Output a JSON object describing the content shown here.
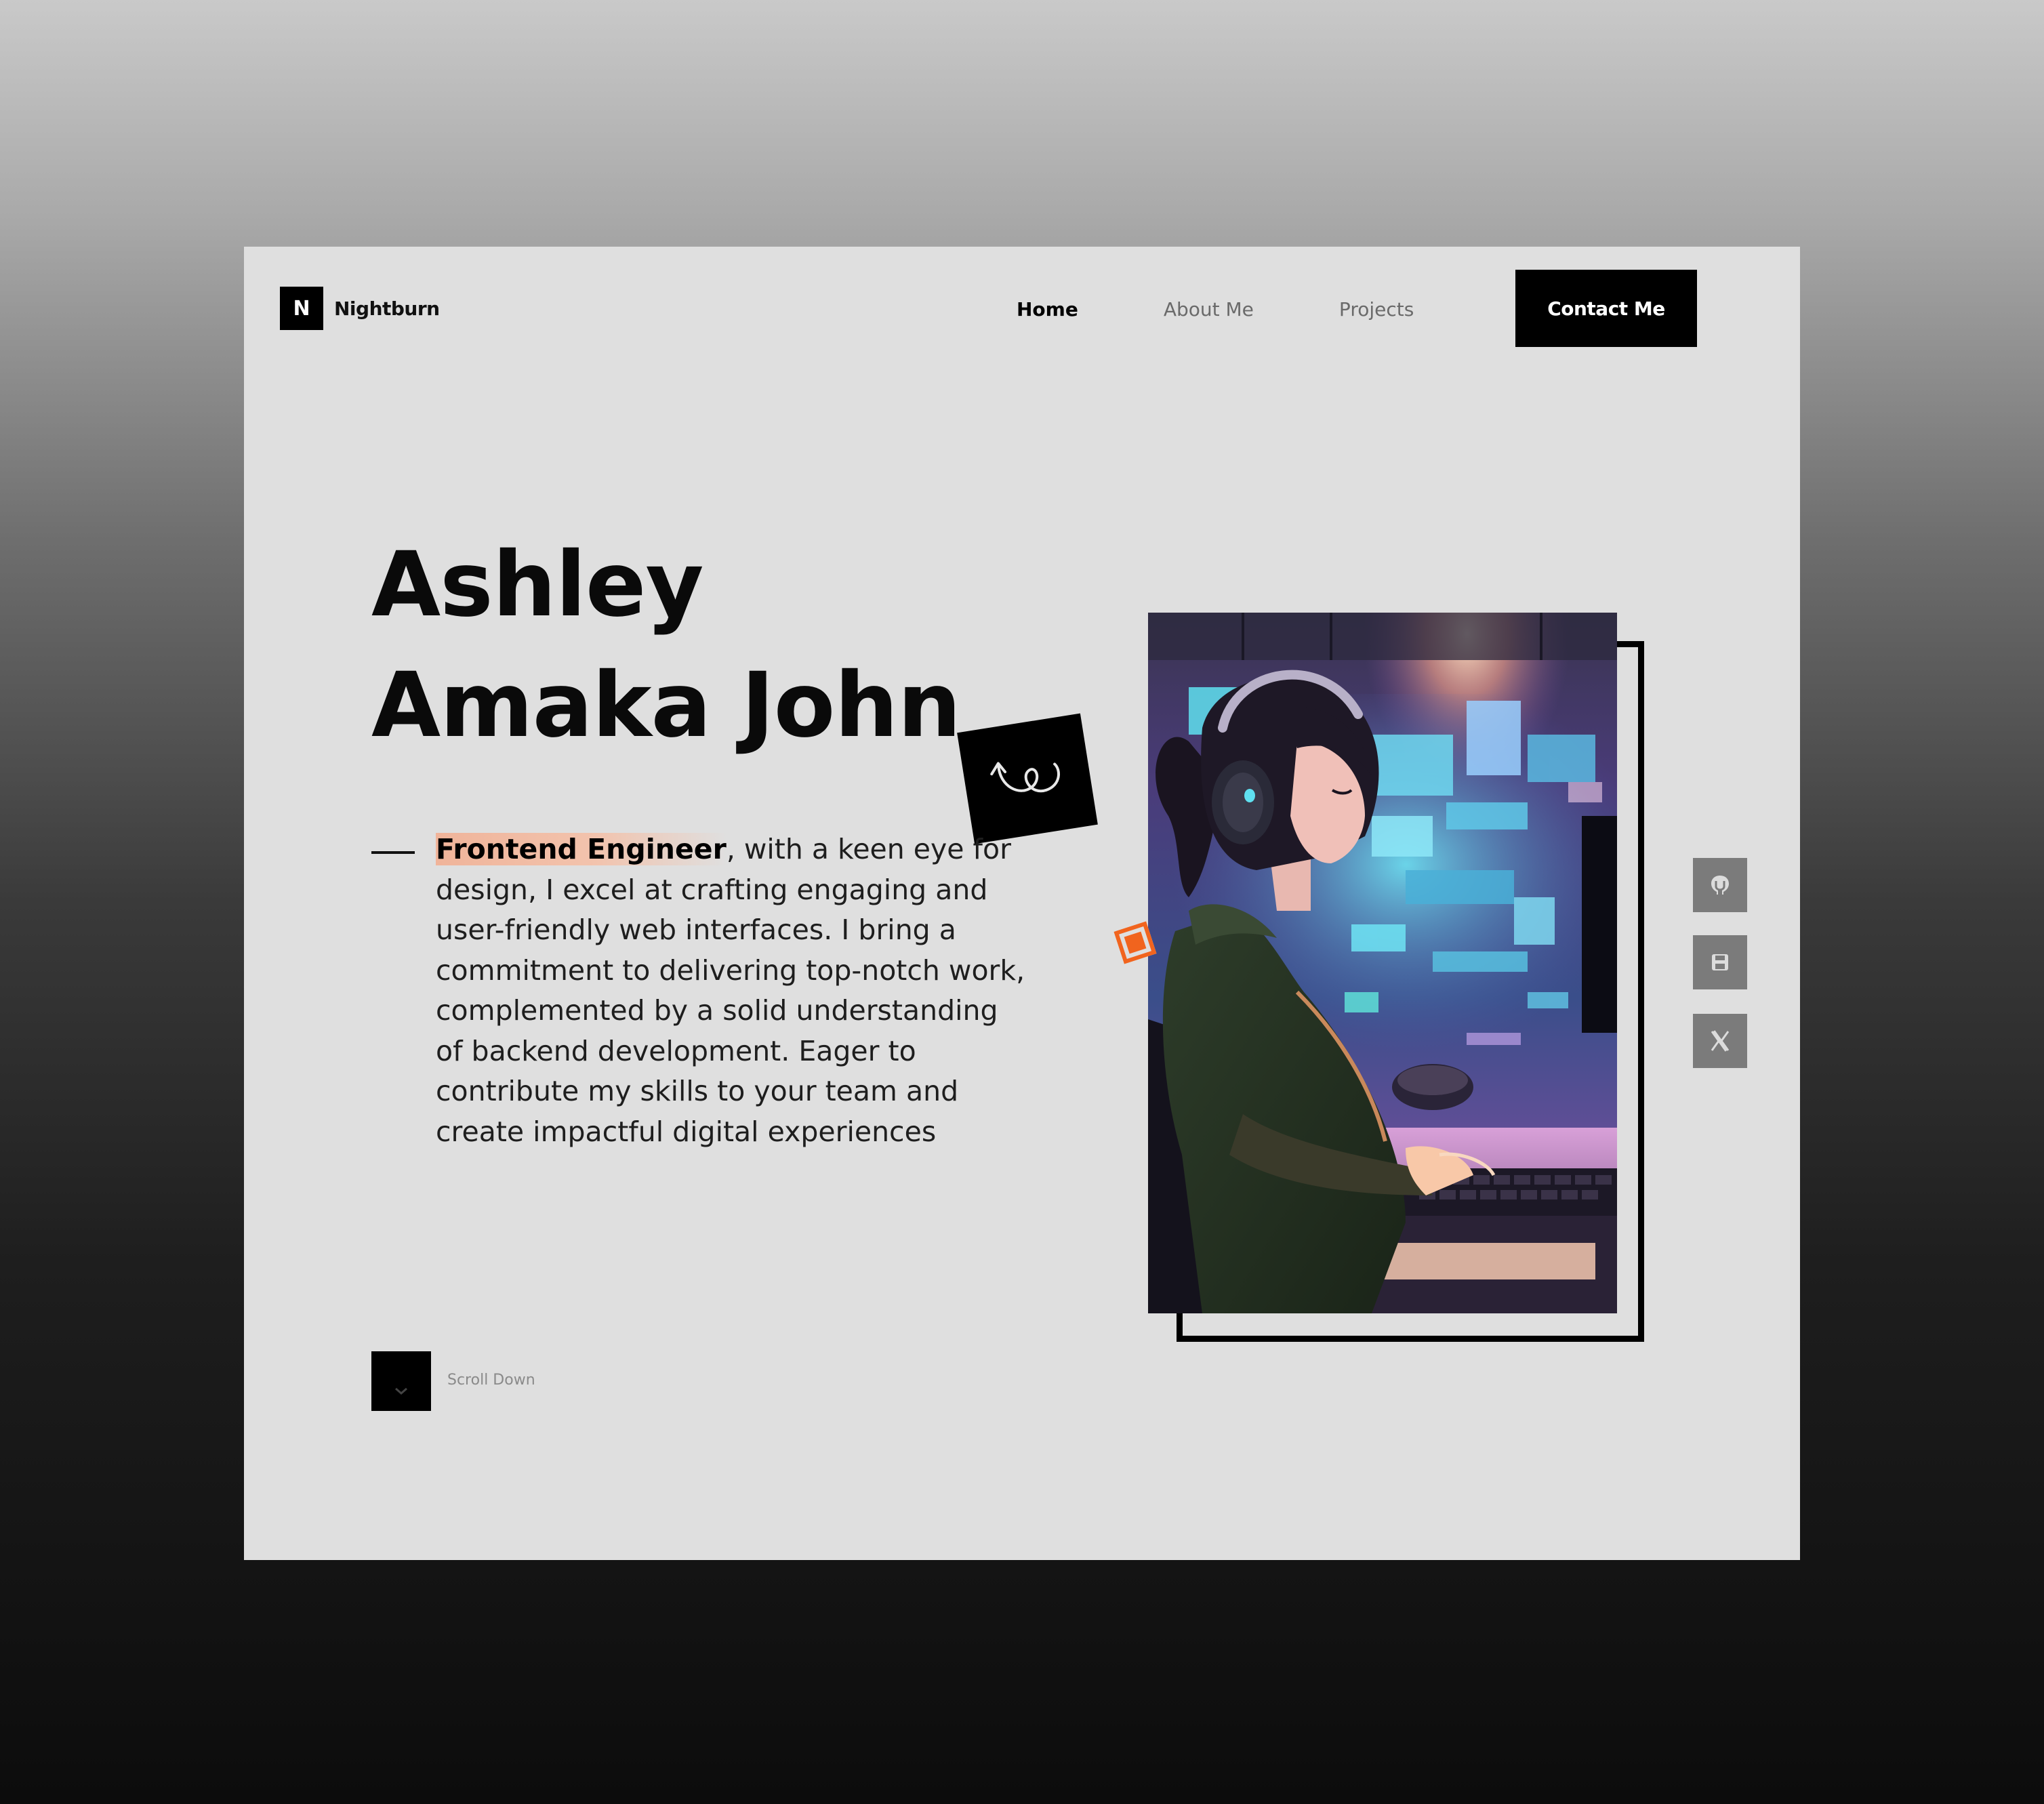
{
  "brand": {
    "logo_letter": "N",
    "name": "Nightburn"
  },
  "nav": {
    "items": [
      {
        "label": "Home",
        "active": true
      },
      {
        "label": "About Me",
        "active": false
      },
      {
        "label": "Projects",
        "active": false
      }
    ],
    "cta_label": "Contact Me"
  },
  "hero": {
    "name_line1": "Ashley",
    "name_line2": "Amaka John",
    "role": "Frontend Engineer",
    "bio_rest": ", with a keen eye for design, I excel at crafting engaging and user-friendly web interfaces. I bring a commitment to delivering top-notch work, complemented by a solid understanding of backend development. Eager to contribute my skills to your team and create impactful digital experiences",
    "scroll_label": "Scroll Down"
  },
  "portrait": {
    "subject": "anime girl with headphones typing at a keyboard in front of glowing monitors"
  },
  "social": {
    "icons": [
      "github-icon",
      "save-icon",
      "x-icon"
    ]
  },
  "colors": {
    "page_bg": "#dfdfdf",
    "primary": "#000000",
    "accent": "#f1641e",
    "highlight": "#f2c3ad",
    "social_bg": "#7b7b7b"
  }
}
